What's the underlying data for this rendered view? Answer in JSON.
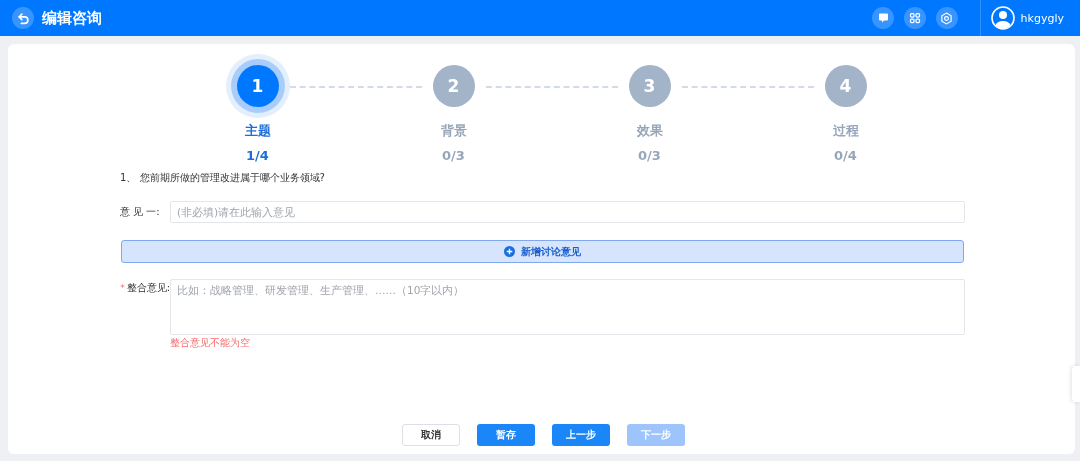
{
  "header": {
    "title": "编辑咨询",
    "username": "hkgygly"
  },
  "steps": [
    {
      "number": "1",
      "label": "主题",
      "count": "1/4",
      "selected": true
    },
    {
      "number": "2",
      "label": "背景",
      "count": "0/3",
      "selected": false
    },
    {
      "number": "3",
      "label": "效果",
      "count": "0/3",
      "selected": false
    },
    {
      "number": "4",
      "label": "过程",
      "count": "0/4",
      "selected": false
    }
  ],
  "question": "1、 您前期所做的管理改进属于哪个业务领域?",
  "opinions": [
    {
      "label": "意 见 一:",
      "placeholder": "(非必填)请在此输入意见"
    }
  ],
  "add_opinion_button": "新增讨论意见",
  "summary": {
    "required_mark": "*",
    "label": "整合意见:",
    "placeholder": "比如：战略管理、研发管理、生产管理、……（10字以内）",
    "error": "整合意见不能为空"
  },
  "buttons": [
    {
      "label": "取消",
      "kind": "outline",
      "disabled": false
    },
    {
      "label": "暂存",
      "kind": "primary",
      "disabled": false
    },
    {
      "label": "上一步",
      "kind": "primary",
      "disabled": false
    },
    {
      "label": "下一步",
      "kind": "primary",
      "disabled": true
    }
  ]
}
